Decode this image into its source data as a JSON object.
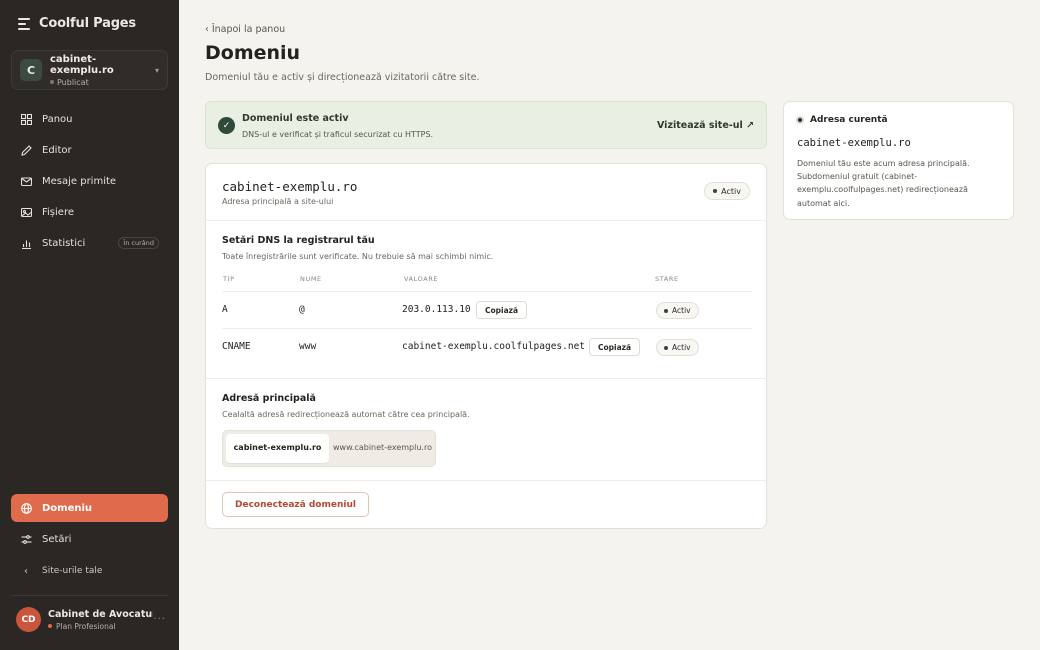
{
  "app": {
    "name": "Coolful Pages"
  },
  "site": {
    "avatar": "C",
    "name": "cabinet-exemplu.ro",
    "status": "Publicat"
  },
  "nav": {
    "items": [
      {
        "id": "panou",
        "label": "Panou",
        "icon": "grid-icon"
      },
      {
        "id": "editor",
        "label": "Editor",
        "icon": "pencil-icon"
      },
      {
        "id": "mesaje",
        "label": "Mesaje primite",
        "icon": "mail-icon"
      },
      {
        "id": "fisiere",
        "label": "Fișiere",
        "icon": "image-icon"
      },
      {
        "id": "statistici",
        "label": "Statistici",
        "icon": "bar-chart-icon",
        "badge": "În curând"
      }
    ],
    "bottom": [
      {
        "id": "domeniu",
        "label": "Domeniu",
        "icon": "globe-icon",
        "active": true
      },
      {
        "id": "setari",
        "label": "Setări",
        "icon": "sliders-icon"
      },
      {
        "id": "site-uri",
        "label": "Site-urile tale",
        "icon": "chevron-left-icon"
      }
    ]
  },
  "user": {
    "initials": "CD",
    "name": "Cabinet de Avocatură",
    "plan": "Plan Profesional"
  },
  "page": {
    "back": "‹ Înapoi la panou",
    "title": "Domeniu",
    "subtitle": "Domeniul tău e activ și direcționează vizitatorii către site."
  },
  "banner": {
    "title": "Domeniul este activ",
    "desc": "DNS-ul e verificat și traficul securizat cu HTTPS.",
    "visit": "Vizitează site-ul ↗"
  },
  "domain": {
    "name": "cabinet-exemplu.ro",
    "sub": "Adresa principală a site-ului",
    "status": "Activ"
  },
  "dns": {
    "title": "Setări DNS la registrarul tău",
    "desc": "Toate înregistrările sunt verificate. Nu trebuie să mai schimbi nimic.",
    "headers": {
      "type": "TIP",
      "name": "NUME",
      "value": "VALOARE",
      "status": "STARE"
    },
    "rows": [
      {
        "type": "A",
        "name": "@",
        "value": "203.0.113.10",
        "copy": "Copiază",
        "status": "Activ"
      },
      {
        "type": "CNAME",
        "name": "www",
        "value": "cabinet-exemplu.coolfulpages.net",
        "copy": "Copiază",
        "status": "Activ"
      }
    ]
  },
  "primary": {
    "title": "Adresă principală",
    "desc": "Cealaltă adresă redirecționează automat către cea principală.",
    "options": [
      "cabinet-exemplu.ro",
      "www.cabinet-exemplu.ro"
    ]
  },
  "disconnect": "Deconectează domeniul",
  "panel": {
    "head": "Adresa curentă",
    "domain": "cabinet-exemplu.ro",
    "desc": "Domeniul tău este acum adresa principală. Subdomeniul gratuit (cabinet-exemplu.coolfulpages.net) redirecționează automat aici."
  }
}
